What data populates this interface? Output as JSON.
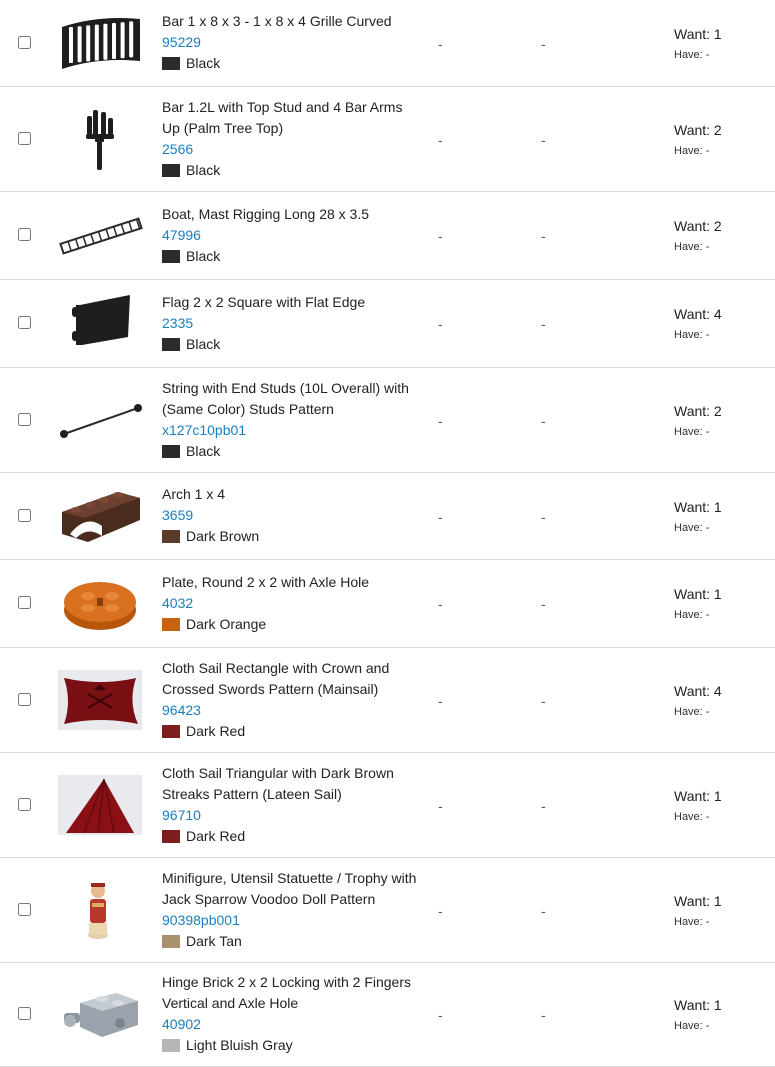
{
  "items": [
    {
      "name": "Bar 1 x 8 x 3 - 1 x 8 x 4 Grille Curved",
      "part": "95229",
      "color": "Black",
      "swatch": "#2b2b2b",
      "col1": "-",
      "col2": "-",
      "want": "Want: 1",
      "have": "Have: -",
      "icon": "grille-part-icon"
    },
    {
      "name": "Bar 1.2L with Top Stud and 4 Bar Arms Up (Palm Tree Top)",
      "part": "2566",
      "color": "Black",
      "swatch": "#2b2b2b",
      "col1": "-",
      "col2": "-",
      "want": "Want: 2",
      "have": "Have: -",
      "icon": "palm-tree-top-part-icon"
    },
    {
      "name": "Boat, Mast Rigging Long 28 x 3.5",
      "part": "47996",
      "color": "Black",
      "swatch": "#2b2b2b",
      "col1": "-",
      "col2": "-",
      "want": "Want: 2",
      "have": "Have: -",
      "icon": "rigging-part-icon"
    },
    {
      "name": "Flag 2 x 2 Square with Flat Edge",
      "part": "2335",
      "color": "Black",
      "swatch": "#2b2b2b",
      "col1": "-",
      "col2": "-",
      "want": "Want: 4",
      "have": "Have: -",
      "icon": "flag-part-icon"
    },
    {
      "name": "String with End Studs (10L Overall) with (Same Color) Studs Pattern",
      "part": "x127c10pb01",
      "color": "Black",
      "swatch": "#2b2b2b",
      "col1": "-",
      "col2": "-",
      "want": "Want: 2",
      "have": "Have: -",
      "icon": "string-part-icon"
    },
    {
      "name": "Arch 1 x 4",
      "part": "3659",
      "color": "Dark Brown",
      "swatch": "#5a3a2a",
      "col1": "-",
      "col2": "-",
      "want": "Want: 1",
      "have": "Have: -",
      "icon": "arch-part-icon"
    },
    {
      "name": "Plate, Round 2 x 2 with Axle Hole",
      "part": "4032",
      "color": "Dark Orange",
      "swatch": "#c8620f",
      "col1": "-",
      "col2": "-",
      "want": "Want: 1",
      "have": "Have: -",
      "icon": "round-plate-part-icon"
    },
    {
      "name": "Cloth Sail Rectangle with Crown and Crossed Swords Pattern (Mainsail)",
      "part": "96423",
      "color": "Dark Red",
      "swatch": "#7d1d1d",
      "col1": "-",
      "col2": "-",
      "want": "Want: 4",
      "have": "Have: -",
      "icon": "mainsail-part-icon"
    },
    {
      "name": "Cloth Sail Triangular with Dark Brown Streaks Pattern (Lateen Sail)",
      "part": "96710",
      "color": "Dark Red",
      "swatch": "#7d1d1d",
      "col1": "-",
      "col2": "-",
      "want": "Want: 1",
      "have": "Have: -",
      "icon": "lateen-sail-part-icon"
    },
    {
      "name": "Minifigure, Utensil Statuette / Trophy with Jack Sparrow Voodoo Doll Pattern",
      "part": "90398pb001",
      "color": "Dark Tan",
      "swatch": "#a8916c",
      "col1": "-",
      "col2": "-",
      "want": "Want: 1",
      "have": "Have: -",
      "icon": "statuette-part-icon"
    },
    {
      "name": "Hinge Brick 2 x 2 Locking with 2 Fingers Vertical and Axle Hole",
      "part": "40902",
      "color": "Light Bluish Gray",
      "swatch": "#b4b6b8",
      "col1": "-",
      "col2": "-",
      "want": "Want: 1",
      "have": "Have: -",
      "icon": "hinge-brick-part-icon"
    }
  ]
}
